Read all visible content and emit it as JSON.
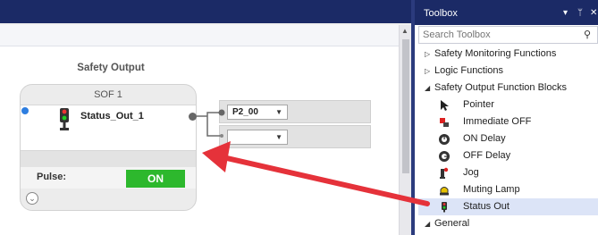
{
  "canvas": {
    "group_title": "Safety Output",
    "block": {
      "header": "SOF 1",
      "output_name": "Status_Out_1",
      "pulse_label": "Pulse:",
      "pulse_value": "ON"
    },
    "ports": [
      {
        "value": "P2_00"
      },
      {
        "value": ""
      }
    ]
  },
  "toolbox": {
    "title": "Toolbox",
    "search_placeholder": "Search Toolbox",
    "categories": [
      {
        "label": "Safety Monitoring Functions",
        "expander": "▷"
      },
      {
        "label": "Logic Functions",
        "expander": "▷"
      },
      {
        "label": "Safety Output Function Blocks",
        "expander": "◢"
      }
    ],
    "items": [
      {
        "label": "Pointer",
        "icon": "pointer-icon"
      },
      {
        "label": "Immediate OFF",
        "icon": "immediate-off-icon"
      },
      {
        "label": "ON Delay",
        "icon": "on-delay-icon"
      },
      {
        "label": "OFF Delay",
        "icon": "off-delay-icon"
      },
      {
        "label": "Jog",
        "icon": "jog-icon"
      },
      {
        "label": "Muting Lamp",
        "icon": "muting-lamp-icon"
      },
      {
        "label": "Status Out",
        "icon": "status-out-icon",
        "selected": true
      }
    ],
    "general": {
      "label": "General",
      "expander": "◢"
    }
  },
  "colors": {
    "title_bar": "#1b2a66",
    "toggle_on": "#2db82d",
    "arrow": "#e5323a",
    "selected_row": "#dce4f7"
  }
}
